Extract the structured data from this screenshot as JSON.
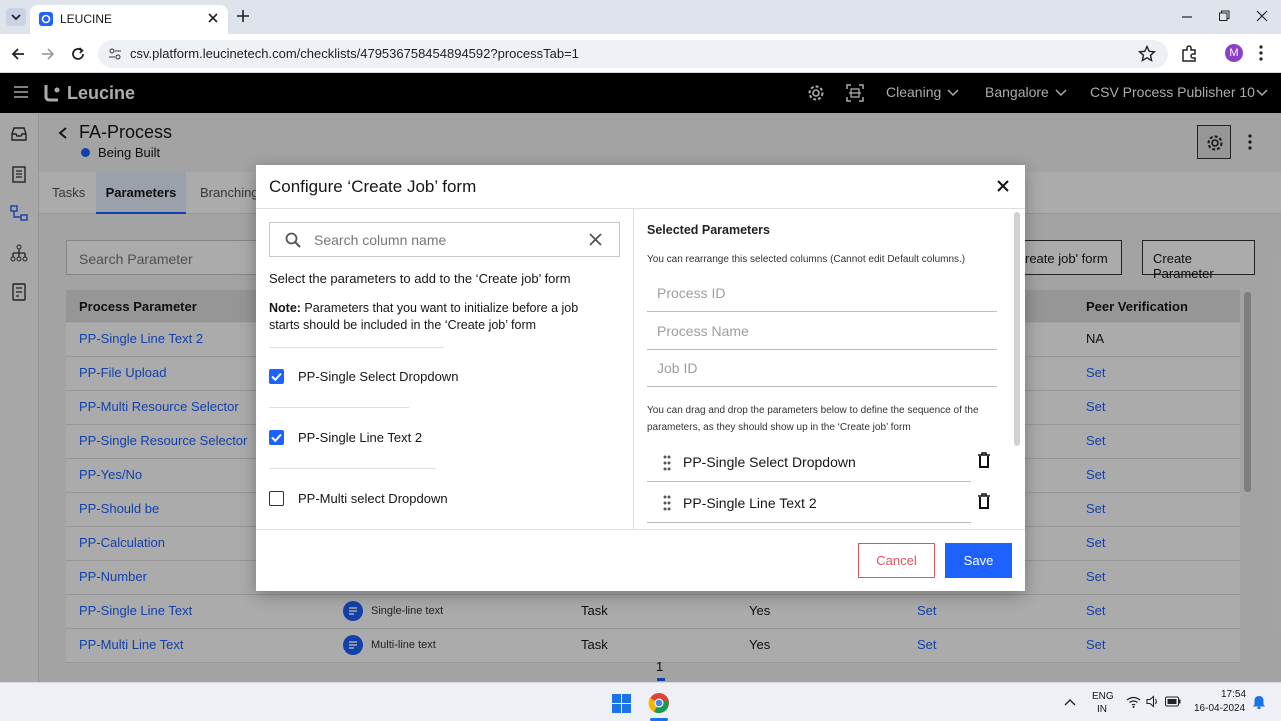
{
  "browser": {
    "tab_title": "LEUCINE",
    "url": "csv.platform.leucinetech.com/checklists/479536758454894592?processTab=1",
    "profile_initial": "M"
  },
  "app": {
    "brand": "Leucine",
    "header_menus": [
      "Cleaning",
      "Bangalore",
      "CSV Process Publisher 10"
    ]
  },
  "page": {
    "title": "FA-Process",
    "status": "Being Built",
    "tabs": [
      "Tasks",
      "Parameters",
      "Branching"
    ],
    "active_tab": "Parameters",
    "search_placeholder": "Search Parameter",
    "configure_button_partial": "reate job' form",
    "create_button": "Create Parameter",
    "table_headers": {
      "col1": "Process Parameter",
      "col_last": "Peer Verification"
    },
    "rows": [
      {
        "name": "PP-Single Line Text 2",
        "peer": "NA"
      },
      {
        "name": "PP-File Upload",
        "peer": "Set"
      },
      {
        "name": "PP-Multi Resource Selector",
        "peer": "Set"
      },
      {
        "name": "PP-Single Resource Selector",
        "peer": "Set"
      },
      {
        "name": "PP-Yes/No",
        "peer": "Set"
      },
      {
        "name": "PP-Should be",
        "peer": "Set"
      },
      {
        "name": "PP-Calculation",
        "peer": "Set"
      },
      {
        "name": "PP-Number",
        "peer": "Set"
      },
      {
        "name": "PP-Single Line Text",
        "type": "Single-line text",
        "target": "Task",
        "mandatory": "Yes",
        "verification": "Set",
        "peer": "Set"
      },
      {
        "name": "PP-Multi Line Text",
        "type": "Multi-line text",
        "target": "Task",
        "mandatory": "Yes",
        "verification": "Set",
        "peer": "Set"
      }
    ],
    "pagination_current": "1"
  },
  "modal": {
    "title": "Configure ‘Create Job’ form",
    "search_placeholder": "Search column name",
    "instruction": "Select the parameters to add to the ‘Create job’ form",
    "note_label": "Note:",
    "note_text": " Parameters that you want to initialize before a job starts should be included in the ‘Create job’ form",
    "options": [
      {
        "label": "PP-Single Select Dropdown",
        "checked": true
      },
      {
        "label": "PP-Single Line Text 2",
        "checked": true
      },
      {
        "label": "PP-Multi select Dropdown",
        "checked": false
      }
    ],
    "selected_title": "Selected Parameters",
    "selected_hint": "You can rearrange this selected columns (Cannot edit Default columns.)",
    "default_columns": [
      "Process ID",
      "Process Name",
      "Job ID"
    ],
    "drag_hint": "You can drag and drop the parameters below to define the sequence of the parameters, as they should show up in the ‘Create job’ form",
    "selected_items": [
      "PP-Single Select Dropdown",
      "PP-Single Line Text 2"
    ],
    "cancel_label": "Cancel",
    "save_label": "Save"
  },
  "taskbar": {
    "lang_line1": "ENG",
    "lang_line2": "IN",
    "time": "17:54",
    "date": "16-04-2024"
  },
  "colors": {
    "accent": "#1d62ff",
    "cancel": "#e5525b",
    "status_dot": "#1d62ff"
  }
}
